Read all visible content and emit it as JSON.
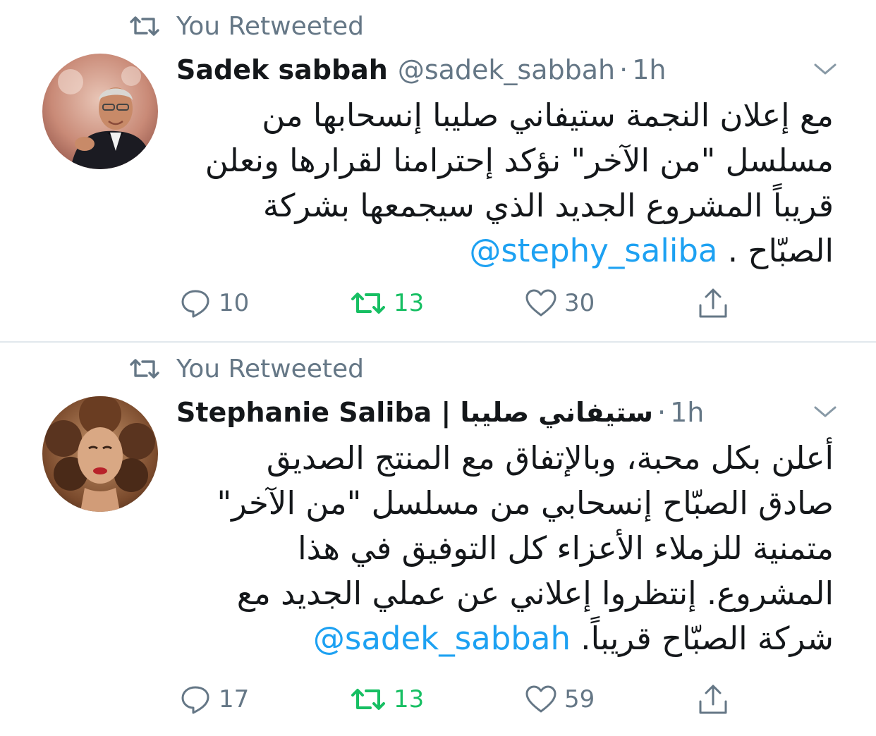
{
  "colors": {
    "accent_blue": "#1da1f2",
    "retweet_green": "#17bf63",
    "secondary_gray": "#657786",
    "divider": "#e1e8ed"
  },
  "tweets": [
    {
      "retweet_label": "You Retweeted",
      "author_name": "Sadek sabbah",
      "handle": "@sadek_sabbah",
      "separator": "·",
      "time": "1h",
      "avatar_icon": "avatar-man-photo",
      "text_lines": [
        "مع إعلان النجمة ستيفاني صليبا إنسحابها من",
        "مسلسل \"من الآخر\" نؤكد إحترامنا لقرارها ونعلن",
        "قريباً المشروع الجديد الذي سيجمعها بشركة"
      ],
      "last_line_text": "الصبّاح . ",
      "mention": "@stephy_saliba",
      "counts": {
        "replies": "10",
        "retweets": "13",
        "likes": "30"
      }
    },
    {
      "retweet_label": "You Retweeted",
      "author_name": "Stephanie Saliba | ستيفاني صليبا",
      "handle": "",
      "separator": "·",
      "time": "1h",
      "avatar_icon": "avatar-woman-photo",
      "text_lines": [
        "أعلن بكل محبة، وبالإتفاق مع المنتج الصديق",
        "صادق الصبّاح إنسحابي من مسلسل \"من الآخر\"",
        "متمنية للزملاء الأعزاء كل التوفيق في هذا",
        "المشروع. إنتظروا إعلاني عن عملي الجديد مع"
      ],
      "last_line_text": "شركة الصبّاح قريباً. ",
      "mention": "@sadek_sabbah",
      "counts": {
        "replies": "17",
        "retweets": "13",
        "likes": "59"
      }
    }
  ],
  "icons": {
    "retweet_small": "retweet-icon",
    "reply": "reply-icon",
    "retweet": "retweet-icon",
    "like": "heart-icon",
    "share": "share-icon",
    "menu": "chevron-down-icon"
  }
}
